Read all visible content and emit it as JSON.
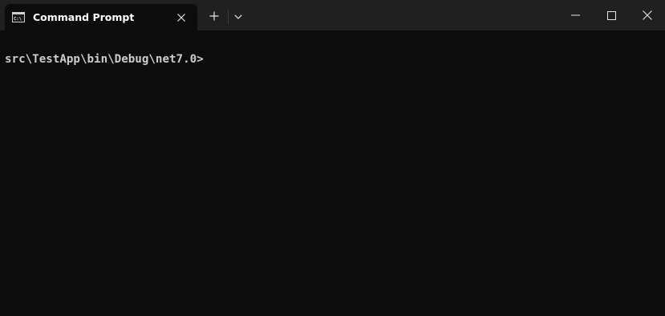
{
  "window": {
    "tab_title": "Command Prompt"
  },
  "icons": {
    "tab_icon": "command-prompt-icon",
    "tab_close": "close-icon",
    "new_tab": "plus-icon",
    "dropdown": "chevron-down-icon",
    "minimize": "minimize-icon",
    "maximize": "maximize-icon",
    "close": "close-icon"
  },
  "terminal": {
    "prompt": "src\\TestApp\\bin\\Debug\\net7.0>"
  },
  "colors": {
    "titlebar_bg": "#202020",
    "terminal_bg": "#0c0c0c",
    "terminal_text": "#cccccc",
    "tab_text": "#ffffff"
  }
}
